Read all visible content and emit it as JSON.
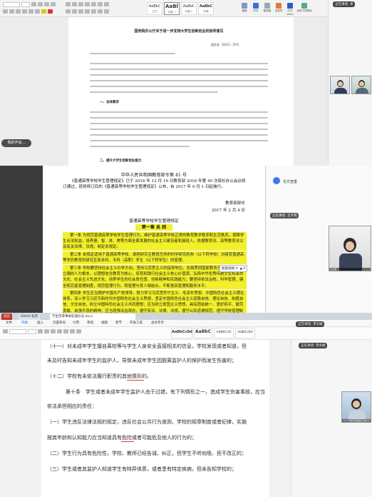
{
  "panel_top": {
    "doc_title": "国务院办公厅关于进一步支持大学生创新创业的指导意见",
    "doc_number": "国办发〔2021〕35号",
    "section1_heading": "一、总体要求",
    "section2_heading": "二、提升大学生创新创业能力",
    "share_pill": "我的开会...",
    "speaking_label": "正在讲话: 宋",
    "ribbon_styles": [
      {
        "sample": "AaBbC",
        "name": "正文"
      },
      {
        "sample": "AaBl",
        "name": "标题 1"
      },
      {
        "sample": "AaBbC",
        "name": "标题 2"
      },
      {
        "sample": "AaBbC",
        "name": "标题"
      }
    ],
    "ribbon_tools": [
      "编辑",
      "听写",
      "敏感度",
      "加载项",
      "打开 Word",
      "适用于的朗读"
    ]
  },
  "panel_mid": {
    "header": "中华人民共和国教育部令第 41 号",
    "intro": "《普通高等学校学生管理规定》已于 2016 年 12 月 16 日教育部 2016 年第 49 次部长办公会议修订通过，现将修订后的《普通高等学校学生管理规定》公布，自 2017 年 9 月 1 日起施行。",
    "signer": "教育部部长",
    "date": "2017 年 2 月 4 日",
    "regulation_title": "普通高等学校学生管理规定",
    "chapter": "第一章 总 则",
    "articles": [
      "第一条 为规范普通高等学校学生管理行为，维护普通高等学校正常的教育教学秩序和生活秩序，保障学生合法权益，培养德、智、体、美等方面全面发展的社会主义建设者和接班人，依据教育法、高等教育法以及有关法律、法规，制定本规定。",
      "第二条 本规定适用于普通高等学校、承担研究生教育任务的科学研究机构（以下称学校）对接受普通高等学历教育的研究生和本科、专科（高职）学生（以下称学生）的管理。",
      "第三条 学校要坚持社会主义办学方向，坚持马克思主义的指导地位，全面贯彻国家教育方针；要坚持以立德树人为根本，以理想信念教育为核心，培育和践行社会主义核心价值观，弘扬中华优秀传统文化和革命文化、社会主义先进文化，培养学生的社会责任感、创新精神和实践能力；要坚持依法治校，科学管理，健全和完善管理制度，规范管理行为，将管理与育人相结合，不断提高管理和服务水平。",
      "第四条 学生应当拥护中国共产党领导，努力学习马克思列宁主义、毛泽东思想、中国特色社会主义理论体系，深入学习习近平新时代中国特色社会主义思想，坚定中国特色社会主义道路自信、理论自信、制度自信、文化自信，树立中国特色社会主义共同理想；应当树立爱国主义思想，具有团结统一、爱好和平、勤劳勇敢、自强不息的精神；应当增强法治观念，遵守宪法、法律、法规，遵守公民道德规范，遵守学校管理制度，具有良好的道德品质和行为习惯；应当刻苦学习，勇于探索，积极实践，努力掌握现代科学文化知识和专业技能；应当积极锻炼身体，增进身心健康，提高个人修养，培养审美情趣。"
    ],
    "side_button": "论文查重",
    "speaking_label": "正在讲话: 王子玥",
    "thumb_caption": "王子玥",
    "float_tip": "图面视图 A- ▲ A"
  },
  "panel_bot": {
    "tabs": [
      "首页",
      "DDHD 稻壳",
      "学生伤害事故处理办法.docx"
    ],
    "menu": [
      "文件",
      "开始",
      "插入",
      "页面布局",
      "引用",
      "审阅",
      "视图",
      "章节",
      "开发工具",
      "会员专享"
    ],
    "menu_active": 1,
    "style_samples": [
      "AaBbCcDd",
      "AaBbC",
      "AaBbCcD",
      "AaBbCcDd"
    ],
    "lines": [
      "（十一）对未成年学生擅自离校等与学生人身安全直接相关的信息，学校发现或者知道，但",
      "未及时告知未成年学生的监护人，导致未成年学生因脱离监护人的保护而发生伤害的；",
      "（十二）学校有未依法履行职责的其他情形的。",
      "第十条　学生或者未成年学生监护人由于过错，有下列情形之一，造成学生伤害事故，应当",
      "依法承担相应的责任：",
      "（一）学生违反法律法规的规定，违反社会公共行为准则、学校的规章制度或者纪律，实施",
      "按其年龄和认知能力应当知道具有危险或者可能危及他人的行为的；",
      "（二）学生行为具有危险性，学校、教师已经告诫、纠正，但学生不听劝阻、拒不改正的；",
      "（三）学生或者其监护人知道学生有特异体质，或者患有特定疾病，但未告知学校的；"
    ],
    "speaking_label1": "正在讲话: 李文娟",
    "speaking_label2": "正在讲话: 李文娟",
    "thumb_caption": "2021年度智慧校园工作会议",
    "colors": {
      "tab_red": "#c0392b",
      "accent_blue": "#1f6fe5",
      "highlight": "#f2ef2b"
    }
  }
}
